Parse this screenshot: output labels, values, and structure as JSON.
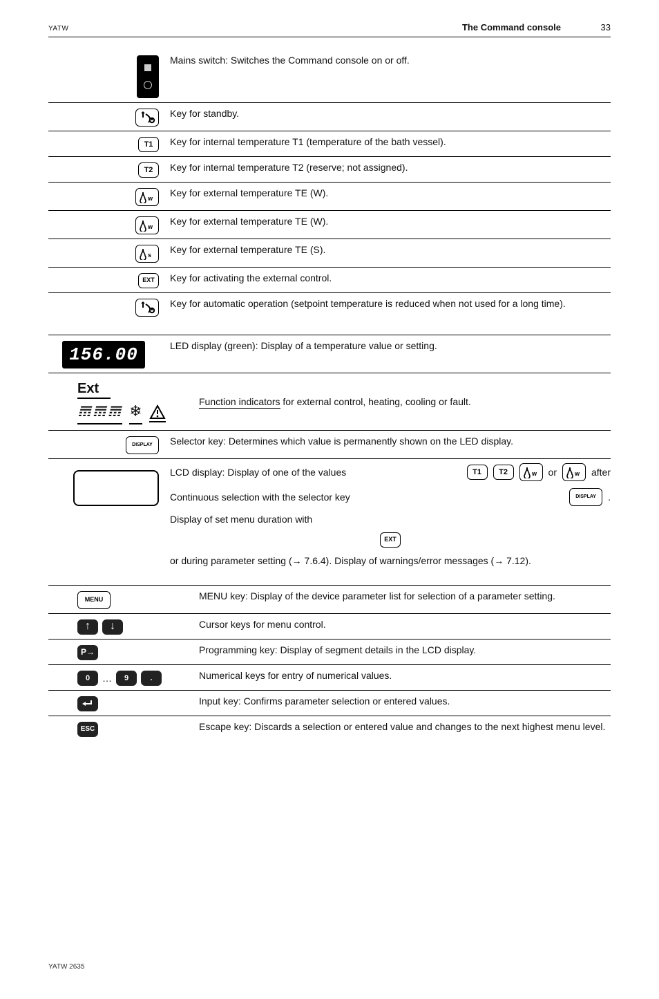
{
  "header": {
    "left": "YATW",
    "title": "The Command console",
    "page": "33"
  },
  "rows": {
    "mains": {
      "desc": "Mains switch: Switches the Command console on or off."
    },
    "standby": {
      "desc": "Key for standby."
    },
    "t1": {
      "label": "T1",
      "desc": "Key for internal temperature T1 (temperature of the bath vessel)."
    },
    "t2": {
      "label": "T2",
      "desc": "Key for internal temperature T2 (reserve; not assigned)."
    },
    "tew": {
      "desc": "Key for external temperature TE (W)."
    },
    "tew2": {
      "desc": "Key for external temperature TE (W)."
    },
    "tes": {
      "desc": "Key for external temperature TE (S)."
    },
    "ext": {
      "label": "EXT",
      "desc": "Key for activating the external control."
    },
    "auto": {
      "desc": "Key for automatic operation (setpoint temperature is reduced when not used for a long time)."
    },
    "lcd": {
      "value": "156.00",
      "desc": "LED display (green): Display of a temperature value or setting."
    },
    "ind": {
      "ext": "Ext",
      "desc_lead": "Function indicators",
      "desc": " for external control, heating, cooling or fault."
    },
    "display": {
      "label": "DISPLAY",
      "desc": "Selector key: Determines which value is permanently shown on the LED display."
    },
    "lcdbox": {
      "line1_pre": "LCD display: Display of one of the values",
      "line1_mid": "or",
      "line1_post": "after",
      "line2_pre": "Continuous selection with the selector key ",
      "line2_post": ".",
      "line3_pre": "Display of set menu duration with ",
      "line3_post": " or during parameter setting (→ 7.6.4). Display of warnings/error messages (→ 7.12)."
    },
    "menu": {
      "label": "MENU",
      "desc": "MENU key: Display of the device parameter list for selection of a parameter setting."
    },
    "updn": {
      "desc": "Cursor keys for menu control."
    },
    "parrow": {
      "label": "P→",
      "desc": "Programming key: Display of segment details in the LCD display."
    },
    "digits": {
      "k0": "0",
      "k9": "9",
      "kdot": ".",
      "desc": "Numerical keys for entry of numerical values."
    },
    "enter": {
      "desc": "Input key: Confirms parameter selection or entered values."
    },
    "esc": {
      "label": "ESC",
      "desc": "Escape key: Discards a selection or entered value and changes to the next highest menu level."
    }
  },
  "footer": "YATW 2635"
}
